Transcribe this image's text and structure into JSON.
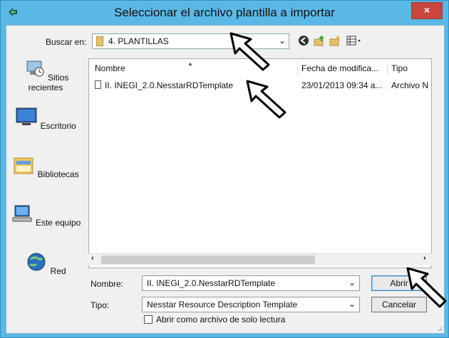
{
  "window": {
    "title": "Seleccionar el archivo plantilla a importar",
    "close_glyph": "×"
  },
  "lookin": {
    "label": "Buscar en:",
    "value": "4. PLANTILLAS"
  },
  "toolbar_icons": [
    "back-icon",
    "up-folder-icon",
    "new-folder-icon",
    "view-menu-icon"
  ],
  "places": [
    {
      "label": "Sitios recientes",
      "icon": "recent-places-icon"
    },
    {
      "label": "Escritorio",
      "icon": "desktop-icon"
    },
    {
      "label": "Bibliotecas",
      "icon": "libraries-icon"
    },
    {
      "label": "Este equipo",
      "icon": "computer-icon"
    },
    {
      "label": "Red",
      "icon": "network-icon"
    }
  ],
  "file_list": {
    "columns": [
      "Nombre",
      "Fecha de modifica...",
      "Tipo"
    ],
    "rows": [
      {
        "name": "II. INEGI_2.0.NesstarRDTemplate",
        "date": "23/01/2013 09:34 a...",
        "type": "Archivo N"
      }
    ]
  },
  "form": {
    "name_label": "Nombre:",
    "name_value": "II. INEGI_2.0.NesstarRDTemplate",
    "type_label": "Tipo:",
    "type_value": "Nesstar Resource Description Template",
    "open_button": "Abrir",
    "cancel_button": "Cancelar",
    "readonly_label": "Abrir como archivo de solo lectura",
    "readonly_checked": false
  },
  "colors": {
    "title_bar": "#5ab8e6",
    "close_button": "#c9463d",
    "client_bg": "#f0f0f0"
  }
}
